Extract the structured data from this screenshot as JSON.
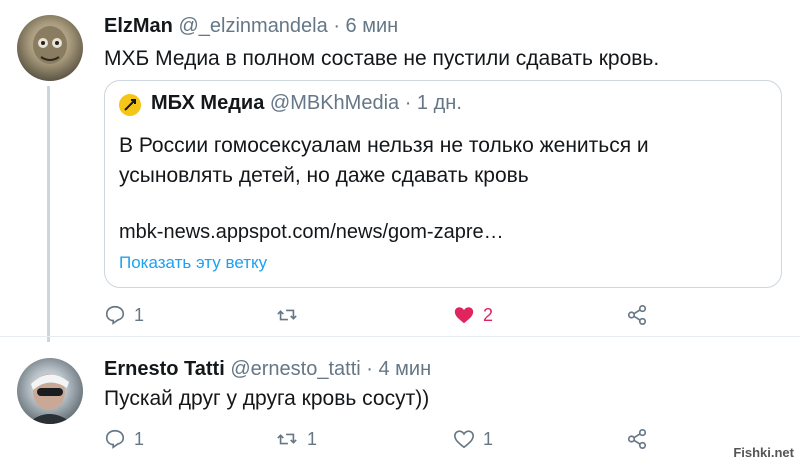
{
  "tweet1": {
    "name": "ElzMan",
    "handle": "@_elzinmandela",
    "time": "· 6 мин",
    "text": "МХБ Медиа  в полном составе не пустили сдавать кровь.",
    "quote": {
      "name": "МБХ Медиа",
      "handle": "@MBKhMedia",
      "time": "· 1 дн.",
      "text": "В России гомосексуалам нельзя не только жениться и усыновлять детей, но даже сдавать кровь",
      "link": "mbk-news.appspot.com/news/gom-zapre…",
      "show_thread": "Показать эту ветку"
    },
    "actions": {
      "replies": "1",
      "retweets": "",
      "likes": "2"
    }
  },
  "tweet2": {
    "name": "Ernesto Tatti",
    "handle": "@ernesto_tatti",
    "time": "· 4 мин",
    "text": "Пускай друг у друга кровь сосут))",
    "actions": {
      "replies": "1",
      "retweets": "1",
      "likes": "1"
    }
  },
  "watermark": "Fishki.net",
  "colors": {
    "accent": "#1da1f2",
    "like": "#e0245e",
    "muted": "#657786"
  },
  "icons": [
    "reply-icon",
    "retweet-icon",
    "like-icon",
    "share-icon"
  ]
}
